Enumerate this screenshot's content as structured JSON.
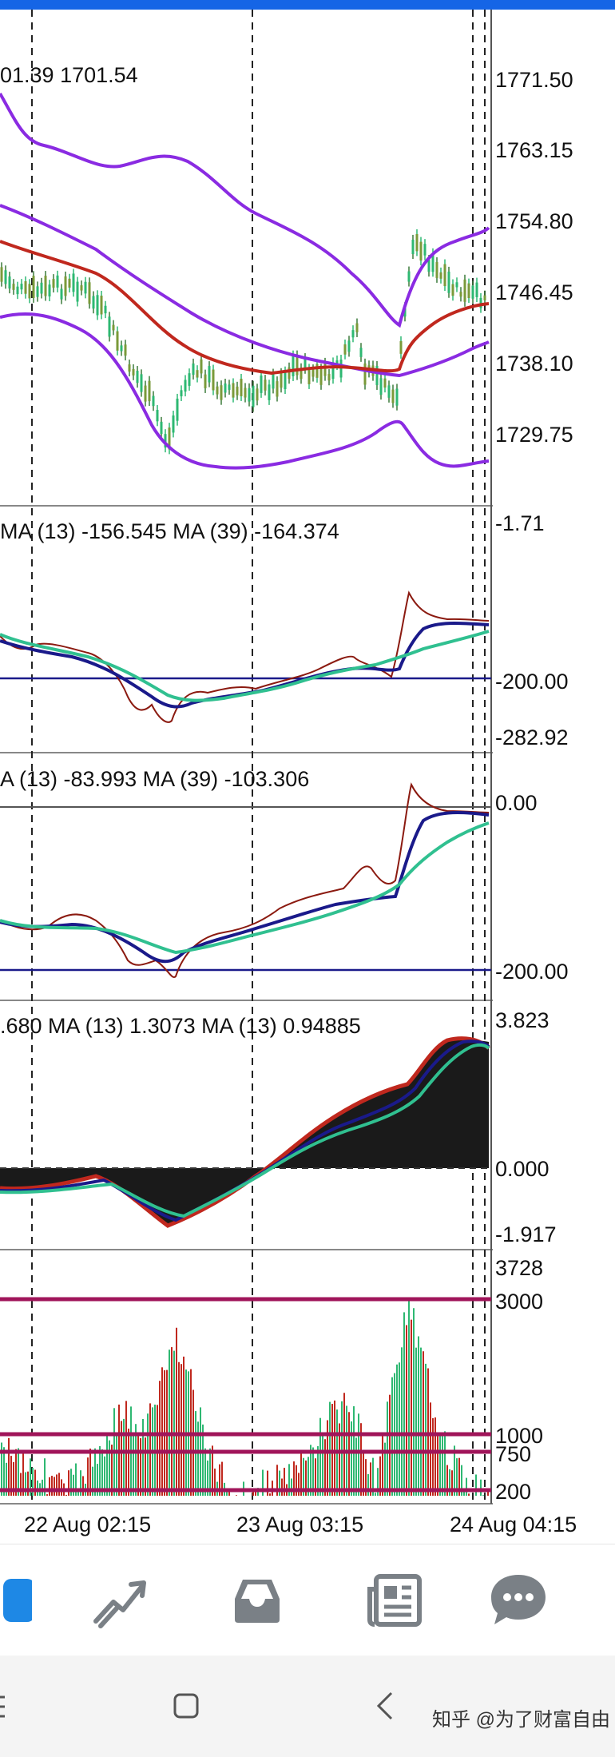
{
  "main_chart": {
    "ohlc_text": "01.39 1701.54",
    "price_labels": [
      "1771.50",
      "1763.15",
      "1754.80",
      "1746.45",
      "1738.10",
      "1729.75"
    ]
  },
  "indicator1": {
    "header": "MA (13)  -156.545 MA (39)  -164.374",
    "levels": [
      "-1.71",
      "-200.00",
      "-282.92"
    ]
  },
  "indicator2": {
    "header": "A (13)  -83.993 MA (39)  -103.306",
    "levels": [
      "0.00",
      "-200.00"
    ]
  },
  "indicator3": {
    "header": ".680 MA (13)  1.3073 MA (13)  0.94885",
    "levels": [
      "3.823",
      "0.000",
      "-1.917"
    ]
  },
  "volume": {
    "levels": [
      "3728",
      "3000",
      "1000",
      "750",
      "200"
    ]
  },
  "time_axis": [
    "22 Aug 02:15",
    "23 Aug 03:15",
    "24 Aug 04:15"
  ],
  "nav": {
    "items": [
      "quotes-icon",
      "chart-icon",
      "trade-icon",
      "news-icon",
      "chat-icon"
    ]
  },
  "system_nav": {
    "items": [
      "menu-icon",
      "home-icon",
      "back-icon"
    ]
  },
  "watermark": "知乎 @为了财富自由",
  "colors": {
    "band": "#8a2be2",
    "ma_red": "#c0281e",
    "candle_green": "#2eb872",
    "line_navy": "#1a1a8a",
    "line_teal": "#30c090",
    "level_magenta": "#a0155a",
    "accent_blue": "#1565e6"
  }
}
